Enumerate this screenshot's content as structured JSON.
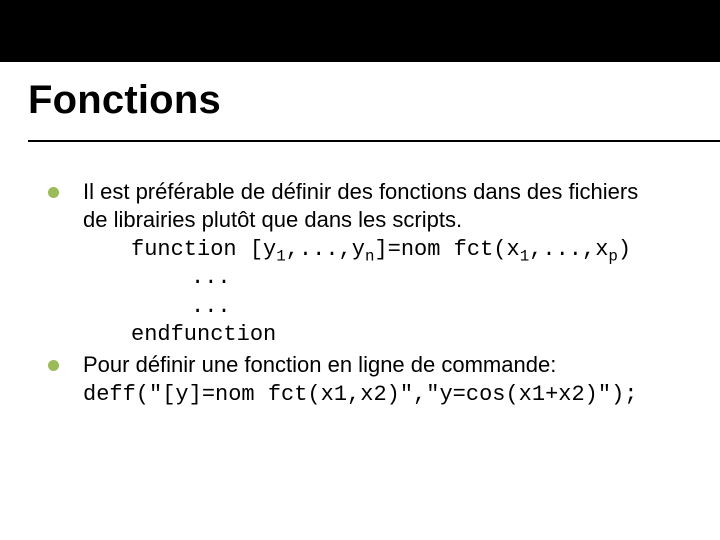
{
  "title": "Fonctions",
  "bullets": [
    {
      "text_line1": "Il est préférable de définir des fonctions dans des fichiers",
      "text_line2": "de librairies plutôt que dans les scripts.",
      "code": {
        "fn_kw": "function",
        "lbr": " [y",
        "s1": "1",
        "mid1": ",...,y",
        "sn": "n",
        "eq": "]=nom fct(x",
        "sx1": "1",
        "mid2": ",...,x",
        "sp": "p",
        "rpar": ")",
        "dots1": "...",
        "dots2": "...",
        "end": "endfunction"
      }
    },
    {
      "text_line1": "Pour définir une fonction en ligne de commande:",
      "code_line": "deff(\"[y]=nom fct(x1,x2)\",\"y=cos(x1+x2)\");"
    }
  ]
}
